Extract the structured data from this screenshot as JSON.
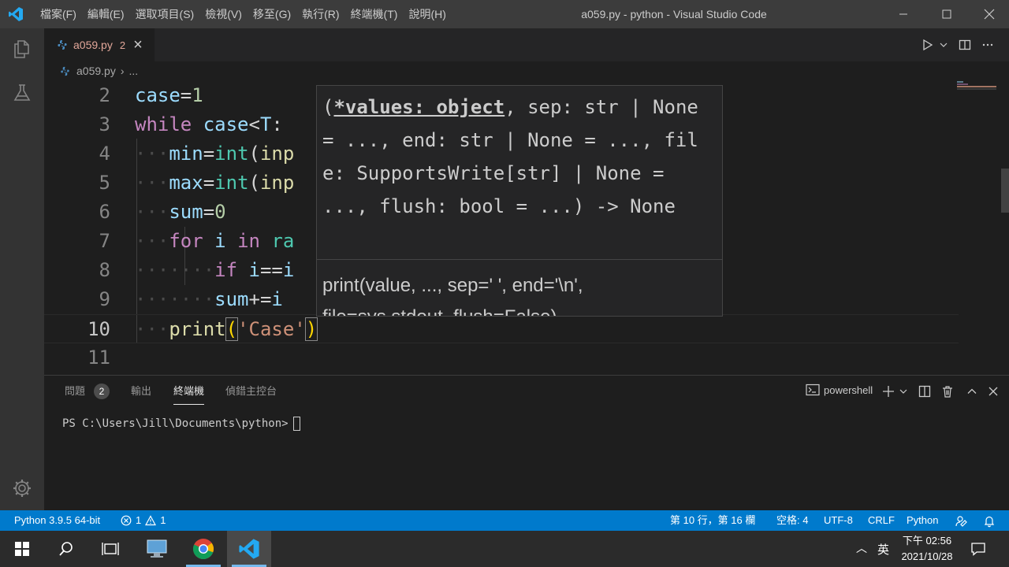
{
  "window": {
    "title": "a059.py - python - Visual Studio Code",
    "menu": [
      "檔案(F)",
      "編輯(E)",
      "選取項目(S)",
      "檢視(V)",
      "移至(G)",
      "執行(R)",
      "終端機(T)",
      "說明(H)"
    ]
  },
  "tab": {
    "name": "a059.py",
    "problem_count": "2",
    "close": "×"
  },
  "breadcrumb": {
    "file": "a059.py",
    "separator": "›",
    "more": "..."
  },
  "editor": {
    "current_line": "10",
    "lines": [
      {
        "no": "2"
      },
      {
        "no": "3"
      },
      {
        "no": "4"
      },
      {
        "no": "5"
      },
      {
        "no": "6"
      },
      {
        "no": "7"
      },
      {
        "no": "8"
      },
      {
        "no": "9"
      },
      {
        "no": "10"
      },
      {
        "no": "11"
      }
    ],
    "code": {
      "l2": [
        "case",
        "=",
        "1"
      ],
      "l3": [
        "while",
        " ",
        "case",
        "<",
        "T",
        ":"
      ],
      "l4": [
        "min",
        "=",
        "int",
        "(",
        "inp"
      ],
      "l5": [
        "max",
        "=",
        "int",
        "(",
        "inp"
      ],
      "l6": [
        "sum",
        "=",
        "0"
      ],
      "l7": [
        "for",
        " ",
        "i",
        " ",
        "in",
        " ",
        "ra"
      ],
      "l8": [
        "if",
        " ",
        "i",
        "==",
        "i"
      ],
      "l9": [
        "sum",
        "+=",
        "i"
      ],
      "l10": [
        "print",
        "(",
        "'Case'",
        ")"
      ]
    }
  },
  "hover": {
    "open_paren": "(",
    "param_bold": "*values: object",
    "signature_rest": ", sep: str | None = ..., end: str | None = ..., file: SupportsWrite[str] | None = ..., flush: bool = ...) -> None",
    "doc_line1": "print(value, ..., sep=' ', end='\\n',",
    "doc_line2": "file=sys.stdout, flush=False)"
  },
  "panel": {
    "tabs": [
      "問題",
      "輸出",
      "終端機",
      "偵錯主控台"
    ],
    "active_tab": "終端機",
    "problems_badge": "2",
    "terminal_name": "powershell",
    "prompt": "PS C:\\Users\\Jill\\Documents\\python>"
  },
  "statusbar": {
    "interpreter": "Python 3.9.5 64-bit",
    "errors": "1",
    "warnings": "1",
    "position": "第 10 行，第 16 欄",
    "spaces": "空格: 4",
    "encoding": "UTF-8",
    "eol": "CRLF",
    "language": "Python"
  },
  "taskbar": {
    "ime": "英",
    "time": "下午 02:56",
    "date": "2021/10/28"
  },
  "colors": {
    "accent": "#007acc",
    "keyword": "#c586c0",
    "variable": "#9cdcfe",
    "function": "#dcdcaa",
    "string": "#ce9178",
    "number": "#b5cea8",
    "type": "#4ec9b0",
    "tab_error": "#e2a79a"
  },
  "icons": [
    "vscode-logo-icon",
    "explorer-icon",
    "testing-icon",
    "gear-icon",
    "python-file-icon",
    "run-icon",
    "split-editor-icon",
    "more-icon",
    "terminal-icon",
    "add-icon",
    "trash-icon",
    "maximize-panel-icon",
    "close-icon",
    "error-icon",
    "warning-icon",
    "feedback-icon",
    "bell-icon",
    "windows-start-icon",
    "search-icon",
    "task-view-icon",
    "chrome-icon",
    "notification-icon"
  ]
}
